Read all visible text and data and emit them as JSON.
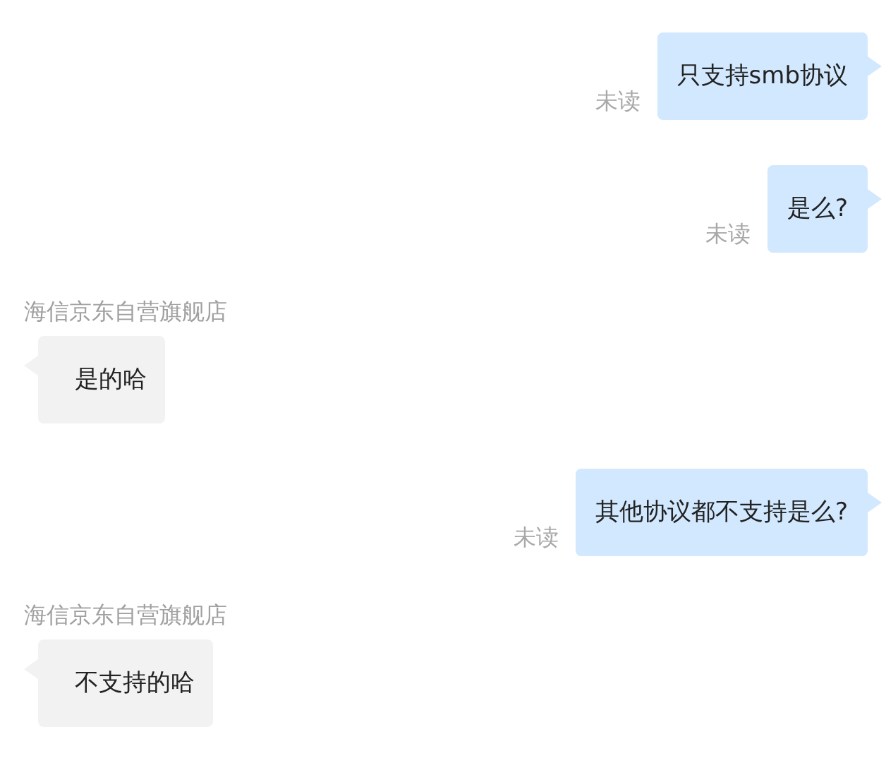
{
  "messages": [
    {
      "kind": "sent",
      "status": "未读",
      "text": "只支持smb协议"
    },
    {
      "kind": "sent",
      "status": "未读",
      "text": "是么?"
    },
    {
      "kind": "received",
      "sender": "海信京东自营旗舰店",
      "text": "是的哈"
    },
    {
      "kind": "sent",
      "status": "未读",
      "text": "其他协议都不支持是么?"
    },
    {
      "kind": "received",
      "sender": "海信京东自营旗舰店",
      "text": "不支持的哈"
    }
  ]
}
